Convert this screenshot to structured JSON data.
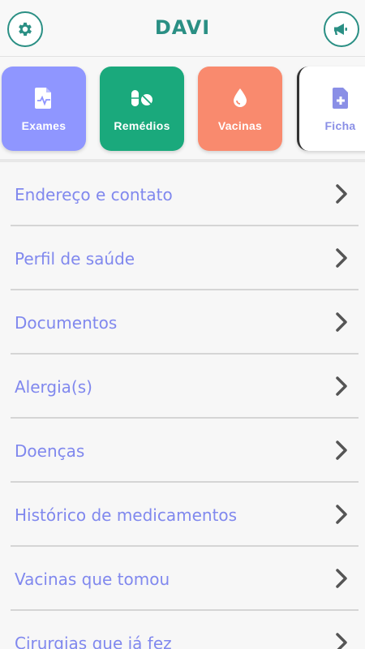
{
  "header": {
    "title": "DAVI",
    "left_icon": "gear-icon",
    "right_icon": "megaphone-icon",
    "accent_color": "#2a8f84"
  },
  "tiles": [
    {
      "label": "Exames",
      "icon": "file-medical-icon",
      "color": "#8f96ff"
    },
    {
      "label": "Remédios",
      "icon": "pills-icon",
      "color": "#1aa97c"
    },
    {
      "label": "Vacinas",
      "icon": "drop-icon",
      "color": "#f98a6e"
    },
    {
      "label": "Ficha",
      "icon": "file-plus-icon",
      "color": "#ffffff"
    }
  ],
  "menu": {
    "items": [
      {
        "label": "Endereço e contato"
      },
      {
        "label": "Perfil de saúde"
      },
      {
        "label": "Documentos"
      },
      {
        "label": "Alergia(s)"
      },
      {
        "label": "Doenças"
      },
      {
        "label": "Histórico de medicamentos"
      },
      {
        "label": "Vacinas que tomou"
      },
      {
        "label": "Cirurgias que já fez"
      }
    ],
    "text_color": "#8088ee",
    "chevron_icon": "chevron-right-icon"
  }
}
